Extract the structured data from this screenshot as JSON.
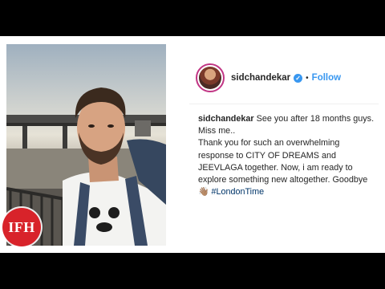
{
  "post": {
    "username": "sidchandekar",
    "verified_glyph": "✓",
    "dot": "•",
    "follow_label": "Follow",
    "caption_user": "sidchandekar",
    "caption_line1": "See you after 18 months guys. Miss me..",
    "caption_line2": "Thank you for such an overwhelming response to CITY OF DREAMS and JEEVLAGA together. Now, i am ready to explore something new altogether. Goodbye",
    "caption_emoji": "👋🏽",
    "hashtag": "#LondonTime"
  },
  "watermark": {
    "label": "IFH",
    "color": "#d8232a"
  },
  "colors": {
    "background": "#000000",
    "card": "#ffffff",
    "link_blue": "#3897f0",
    "hashtag": "#003569"
  },
  "icons": [
    "verified-badge-icon",
    "avatar"
  ]
}
